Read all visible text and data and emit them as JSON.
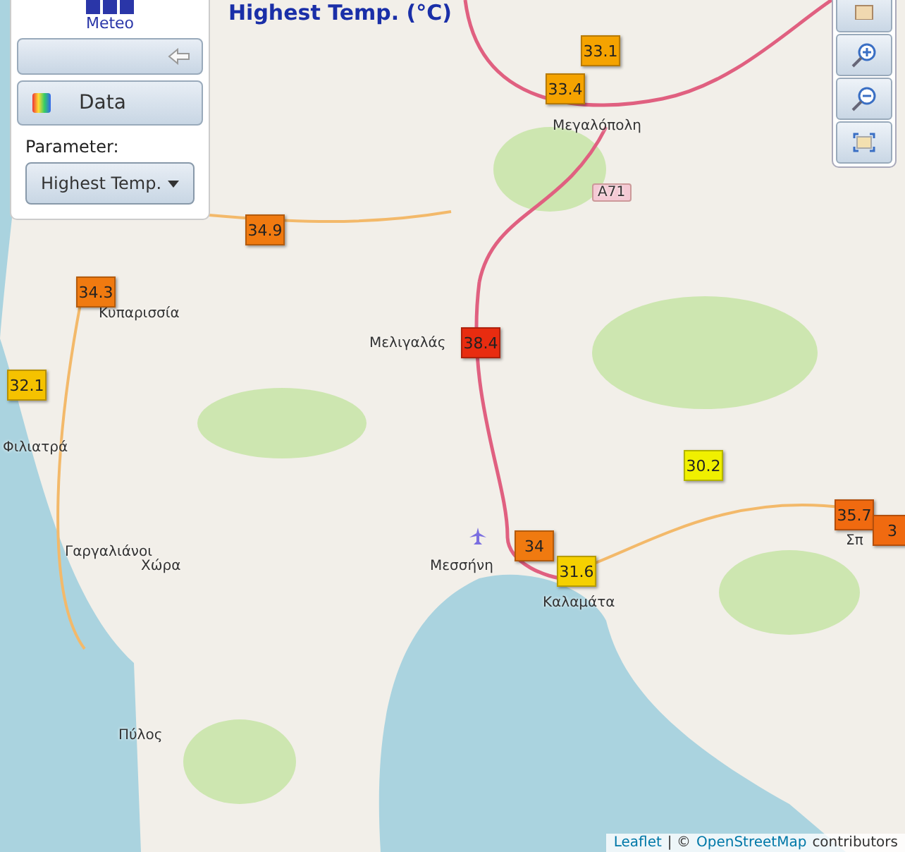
{
  "map_title": "Highest Temp. (°C)",
  "panel": {
    "logo_text": "Meteo",
    "data_button": "Data",
    "parameter_label": "Parameter:",
    "parameter_value": "Highest Temp."
  },
  "places": [
    {
      "name": "Μεγαλόπολη",
      "kind": "town"
    },
    {
      "name": "A71",
      "kind": "road"
    },
    {
      "name": "Κυπαρισσία",
      "kind": "town"
    },
    {
      "name": "Μελιγαλάς",
      "kind": "town"
    },
    {
      "name": "Φιλιατρά",
      "kind": "town"
    },
    {
      "name": "Γαργαλιάνοι",
      "kind": "town"
    },
    {
      "name": "Χώρα",
      "kind": "town"
    },
    {
      "name": "Μεσσήνη",
      "kind": "town"
    },
    {
      "name": "Καλαμάτα",
      "kind": "town"
    },
    {
      "name": "Σπ",
      "kind": "town"
    },
    {
      "name": "Πύλος",
      "kind": "town"
    }
  ],
  "stations": [
    {
      "value": "33.1",
      "color": "#f5a300"
    },
    {
      "value": "33.4",
      "color": "#f5a300"
    },
    {
      "value": "34.9",
      "color": "#f07a10"
    },
    {
      "value": "34.3",
      "color": "#f07a10"
    },
    {
      "value": "32.1",
      "color": "#f5c200"
    },
    {
      "value": "38.4",
      "color": "#e82c10"
    },
    {
      "value": "30.2",
      "color": "#f0f000"
    },
    {
      "value": "35.7",
      "color": "#f06a10"
    },
    {
      "value": "3",
      "color": "#f06a10"
    },
    {
      "value": "34",
      "color": "#f07a10"
    },
    {
      "value": "31.6",
      "color": "#f5d000"
    }
  ],
  "attribution": {
    "leaflet": "Leaflet",
    "separator": "| ©",
    "osm": "OpenStreetMap",
    "suffix": "contributors"
  }
}
